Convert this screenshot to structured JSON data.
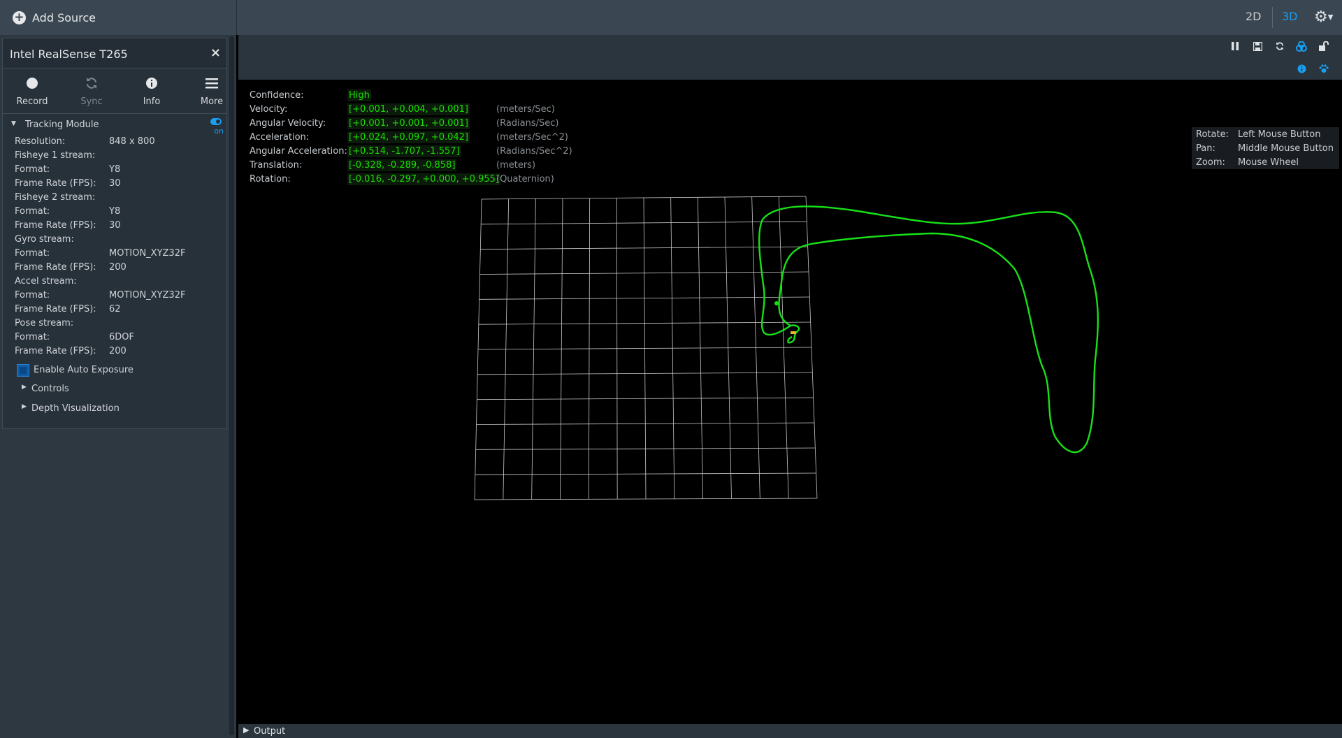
{
  "topbar": {
    "add_source_label": "Add Source",
    "view_2d": "2D",
    "view_3d": "3D",
    "active_view": "3D",
    "accent_color": "#1a9ef0"
  },
  "device": {
    "title": "Intel RealSense T265",
    "buttons": [
      {
        "label": "Record",
        "icon": "record-icon"
      },
      {
        "label": "Sync",
        "icon": "sync-icon",
        "enabled": false
      },
      {
        "label": "Info",
        "icon": "info-icon"
      },
      {
        "label": "More",
        "icon": "menu-icon"
      }
    ],
    "module": {
      "name": "Tracking Module",
      "toggle_label": "on",
      "properties": [
        {
          "key": "Resolution:",
          "value": "848 x 800"
        },
        {
          "key": "Fisheye 1 stream:",
          "value": ""
        },
        {
          "key": "Format:",
          "value": "Y8"
        },
        {
          "key": "Frame Rate (FPS):",
          "value": "30"
        },
        {
          "key": "Fisheye 2 stream:",
          "value": ""
        },
        {
          "key": "Format:",
          "value": "Y8"
        },
        {
          "key": "Frame Rate (FPS):",
          "value": "30"
        },
        {
          "key": "Gyro stream:",
          "value": ""
        },
        {
          "key": "Format:",
          "value": "MOTION_XYZ32F"
        },
        {
          "key": "Frame Rate (FPS):",
          "value": "200"
        },
        {
          "key": "Accel stream:",
          "value": ""
        },
        {
          "key": "Format:",
          "value": "MOTION_XYZ32F"
        },
        {
          "key": "Frame Rate (FPS):",
          "value": "62"
        },
        {
          "key": "Pose stream:",
          "value": ""
        },
        {
          "key": "Format:",
          "value": "6DOF"
        },
        {
          "key": "Frame Rate (FPS):",
          "value": "200"
        }
      ],
      "auto_exposure_label": "Enable Auto Exposure",
      "auto_exposure_checked": true,
      "expanders": [
        "Controls",
        "Depth Visualization"
      ]
    }
  },
  "viewport": {
    "toolbar_icons": [
      "pause-icon",
      "save-icon",
      "reset-icon",
      "trajectory-icon",
      "unlock-icon",
      "info-icon",
      "paw-icon"
    ],
    "pose": [
      {
        "key": "Confidence:",
        "value": "High",
        "unit": ""
      },
      {
        "key": "Velocity:",
        "value": "[+0.001, +0.004, +0.001]",
        "unit": "(meters/Sec)"
      },
      {
        "key": "Angular Velocity:",
        "value": "[+0.001, +0.001, +0.001]",
        "unit": "(Radians/Sec)"
      },
      {
        "key": "Acceleration:",
        "value": "[+0.024, +0.097, +0.042]",
        "unit": "(meters/Sec^2)"
      },
      {
        "key": "Angular Acceleration:",
        "value": "[+0.514, -1.707, -1.557]",
        "unit": "(Radians/Sec^2)"
      },
      {
        "key": "Translation:",
        "value": "[-0.328, -0.289, -0.858]",
        "unit": "(meters)"
      },
      {
        "key": "Rotation:",
        "value": "[-0.016, -0.297, +0.000, +0.955]",
        "unit": "(Quaternion)"
      }
    ],
    "help": [
      {
        "key": "Rotate:",
        "value": "Left Mouse Button"
      },
      {
        "key": "Pan:",
        "value": "Middle Mouse Button"
      },
      {
        "key": "Zoom:",
        "value": "Mouse Wheel"
      }
    ],
    "trajectory_color": "#18e018",
    "grid_color": "#c8c8c8"
  },
  "output": {
    "label": "Output"
  }
}
